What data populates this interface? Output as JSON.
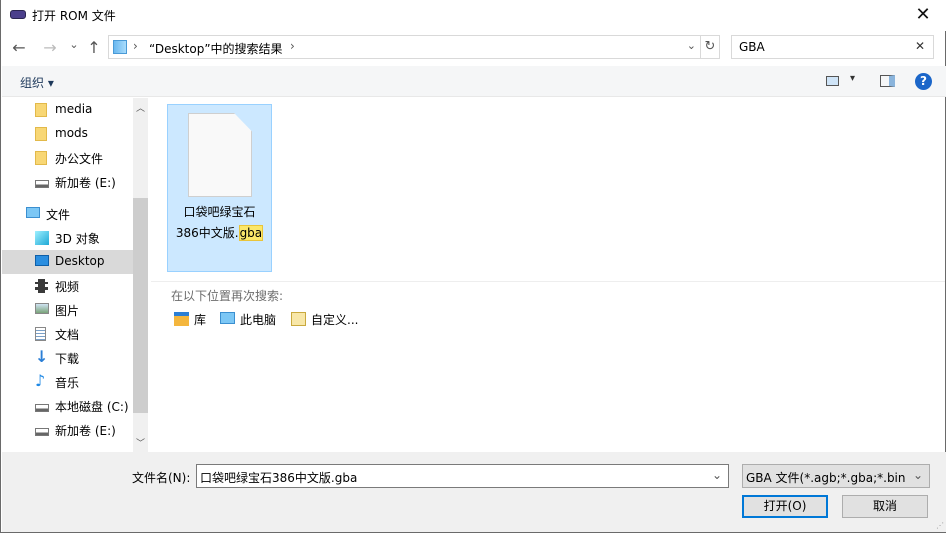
{
  "window": {
    "title": "打开 ROM 文件",
    "close": "✕"
  },
  "nav_buttons": {
    "back": "←",
    "forward": "→",
    "recent": "⌄",
    "up": "↑"
  },
  "address": {
    "sep": "›",
    "path": "“Desktop”中的搜索结果",
    "dropdown": "⌄",
    "refresh": "↻"
  },
  "search": {
    "value": "GBA",
    "clear": "✕"
  },
  "toolbar": {
    "organize": "组织 ▾",
    "view_dropdown": "▾",
    "help": "?"
  },
  "sidebar": {
    "items": [
      {
        "label": "media",
        "icon": "folder"
      },
      {
        "label": "mods",
        "icon": "folder"
      },
      {
        "label": "办公文件",
        "icon": "folder"
      },
      {
        "label": "新加卷 (E:)",
        "icon": "drive"
      },
      {
        "label": "文件",
        "icon": "computer"
      },
      {
        "label": "3D 对象",
        "icon": "3d-objects"
      },
      {
        "label": "Desktop",
        "icon": "desktop",
        "selected": true
      },
      {
        "label": "视频",
        "icon": "video"
      },
      {
        "label": "图片",
        "icon": "pictures"
      },
      {
        "label": "文档",
        "icon": "documents"
      },
      {
        "label": "下载",
        "icon": "download"
      },
      {
        "label": "音乐",
        "icon": "music"
      },
      {
        "label": "本地磁盘 (C:)",
        "icon": "drive"
      },
      {
        "label": "新加卷 (E:)",
        "icon": "drive"
      }
    ]
  },
  "file": {
    "name_part1": "口袋吧绿宝石",
    "name_part2": "386中文版.",
    "ext": "gba"
  },
  "search_again": {
    "label": "在以下位置再次搜索:",
    "locations": [
      {
        "label": "库",
        "icon": "library"
      },
      {
        "label": "此电脑",
        "icon": "computer"
      },
      {
        "label": "自定义...",
        "icon": "custom"
      }
    ]
  },
  "bottom": {
    "filename_label": "文件名(N):",
    "filename_value": "口袋吧绿宝石386中文版.gba",
    "filter": "GBA 文件(*.agb;*.gba;*.bin;*.elf)",
    "open": "打开(O)",
    "cancel": "取消"
  },
  "colors": {
    "selection": "#cce8ff",
    "accent": "#0078d7",
    "highlight": "#fbe76a"
  }
}
